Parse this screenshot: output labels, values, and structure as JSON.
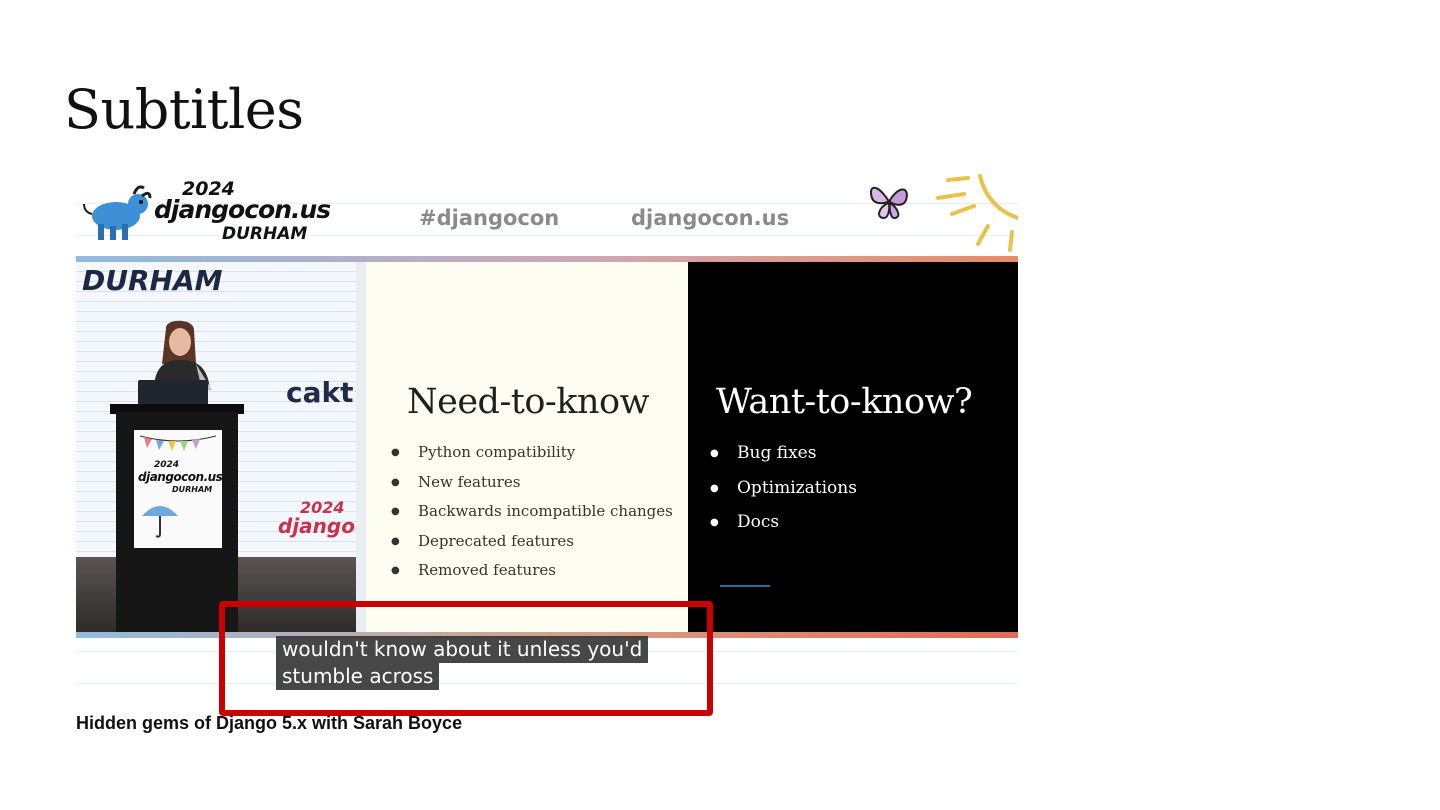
{
  "page": {
    "title": "Subtitles",
    "video_caption": "Hidden gems of Django 5.x with Sarah Boyce"
  },
  "video": {
    "header": {
      "logo_year": "2024",
      "logo_name": "djangocon.us",
      "logo_city": "DURHAM",
      "hashtag": "#djangocon",
      "website": "djangocon.us"
    },
    "camera": {
      "backdrop_city": "DURHAM",
      "sponsor": "cakt",
      "backdrop_year": "2024",
      "backdrop_name": "djangoc",
      "podium_year": "2024",
      "podium_name": "djangocon.us",
      "podium_city": "DURHAM"
    },
    "slide": {
      "left_heading": "Need-to-know",
      "left_items": [
        "Python compatibility",
        "New features",
        "Backwards incompatible changes",
        "Deprecated features",
        "Removed features"
      ],
      "right_heading": "Want-to-know?",
      "right_items": [
        "Bug fixes",
        "Optimizations",
        "Docs"
      ]
    },
    "subtitles": [
      "wouldn't know about it unless you'd",
      "stumble across"
    ]
  },
  "colors": {
    "highlight": "#cc0000",
    "subtitle_bg": "#373737",
    "dark_panel": "#000000",
    "light_panel": "#fefdf1"
  }
}
